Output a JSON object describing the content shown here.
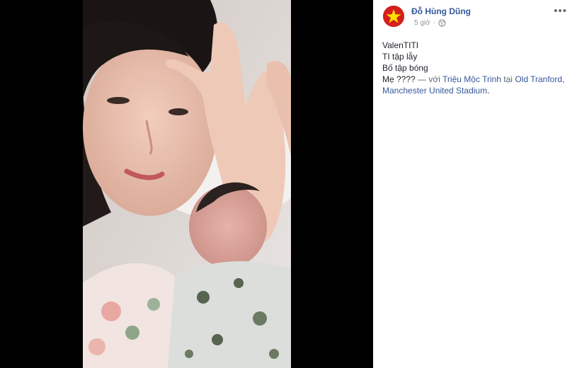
{
  "post": {
    "author": "Đỗ Hùng Dũng",
    "time": "5 giờ",
    "dot": "·",
    "more": "•••",
    "lines": [
      "ValenTITI",
      "TI tập lẫy",
      "Bố tập bóng"
    ],
    "last_line_prefix": "Mẹ ???? ",
    "with_sep": "— với ",
    "tagged_person": "Triệu Mộc Trinh",
    "at_word": " tại ",
    "location": "Old Tranford, Manchester United Stadium",
    "end": "."
  },
  "icons": {
    "privacy": "globe-icon",
    "menu": "more-options-icon",
    "avatar": "vietnam-flag-avatar"
  },
  "colors": {
    "link": "#365899",
    "text": "#1d2129",
    "secondary": "#90949c",
    "viewer_bg": "#000000",
    "flag_red": "#d3201b",
    "flag_star": "#ffde00"
  }
}
